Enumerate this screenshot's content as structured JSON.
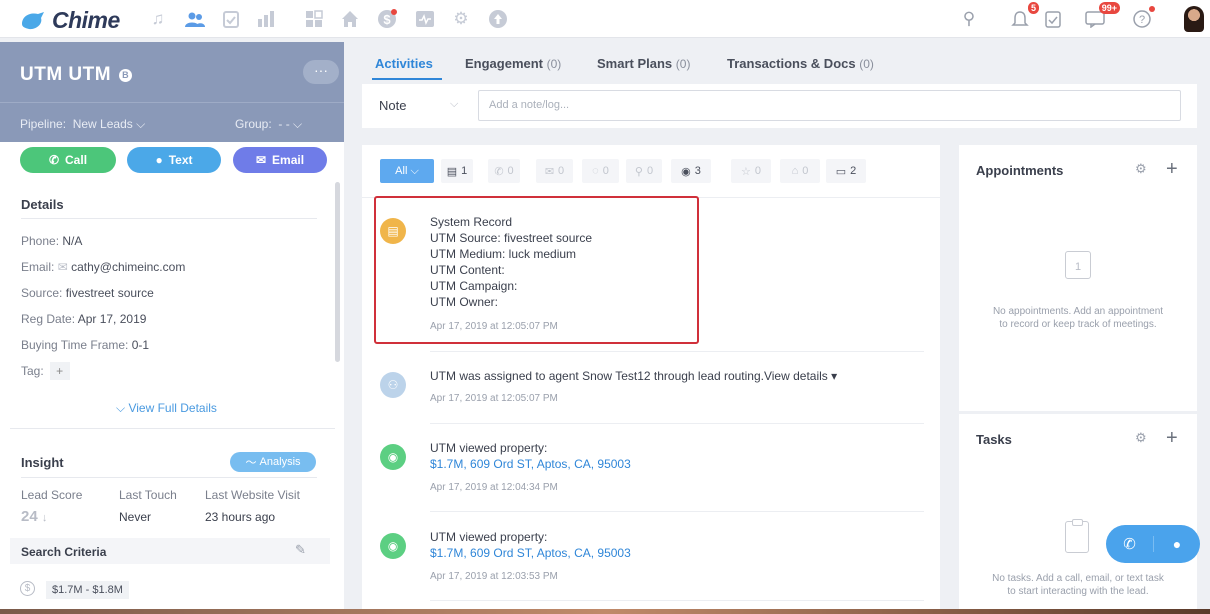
{
  "app": {
    "logo_text": "Chime"
  },
  "nav": {
    "notif_badge": "5",
    "messages_badge": "99+"
  },
  "lead": {
    "name": "UTM UTM",
    "b_badge": "B",
    "more": "···",
    "pipeline_label": "Pipeline:",
    "pipeline_value": "New Leads",
    "group_label": "Group:",
    "group_value": "- -"
  },
  "actions": {
    "call": "Call",
    "text": "Text",
    "email": "Email"
  },
  "details": {
    "title": "Details",
    "phone_label": "Phone:",
    "phone_value": "N/A",
    "email_label": "Email:",
    "email_value": "cathy@chimeinc.com",
    "source_label": "Source:",
    "source_value": "fivestreet source",
    "reg_label": "Reg Date:",
    "reg_value": "Apr 17, 2019",
    "btf_label": "Buying Time Frame:",
    "btf_value": "0-1",
    "tag_label": "Tag:",
    "tag_add": "+",
    "view_full": "View Full Details"
  },
  "insight": {
    "title": "Insight",
    "analysis": "Analysis",
    "lead_score_label": "Lead Score",
    "last_touch_label": "Last Touch",
    "last_visit_label": "Last Website Visit",
    "lead_score": "24",
    "last_touch": "Never",
    "last_visit": "23 hours ago",
    "search_criteria": "Search Criteria",
    "price": "$1.7M - $1.8M"
  },
  "tabs": [
    {
      "label": "Activities",
      "count": ""
    },
    {
      "label": "Engagement",
      "count": "(0)"
    },
    {
      "label": "Smart Plans",
      "count": "(0)"
    },
    {
      "label": "Transactions & Docs",
      "count": "(0)"
    }
  ],
  "note": {
    "type": "Note",
    "placeholder": "Add a note/log..."
  },
  "filters": {
    "all": "All",
    "chips": [
      {
        "icon": "▤",
        "count": "1"
      },
      {
        "icon": "✆",
        "count": "0"
      },
      {
        "icon": "✉",
        "count": "0"
      },
      {
        "icon": "◌",
        "count": "0"
      },
      {
        "icon": "⚲",
        "count": "0"
      },
      {
        "icon": "◉",
        "count": "3"
      },
      {
        "icon": "☆",
        "count": "0"
      },
      {
        "icon": "⌂",
        "count": "0"
      },
      {
        "icon": "▭",
        "count": "2"
      }
    ]
  },
  "activities": [
    {
      "lines": [
        "System Record",
        "UTM Source: fivestreet source",
        "UTM Medium: luck medium",
        "UTM Content:",
        "UTM Campaign:",
        "UTM Owner:"
      ],
      "time": "Apr 17, 2019 at 12:05:07 PM",
      "color": "#f0b54a"
    },
    {
      "text": "UTM was assigned to agent Snow Test12 through lead routing.View details",
      "time": "Apr 17, 2019 at 12:05:07 PM",
      "color": "#bcd3ea"
    },
    {
      "text": "UTM viewed property:",
      "link": "$1.7M, 609 Ord ST, Aptos, CA, 95003",
      "time": "Apr 17, 2019 at 12:04:34 PM",
      "color": "#5ccf82"
    },
    {
      "text": "UTM viewed property:",
      "link": "$1.7M, 609 Ord ST, Aptos, CA, 95003",
      "time": "Apr 17, 2019 at 12:03:53 PM",
      "color": "#5ccf82"
    }
  ],
  "appointments": {
    "title": "Appointments",
    "empty": "No appointments. Add an appointment to record or keep track of meetings.",
    "cal_day": "1"
  },
  "tasks": {
    "title": "Tasks",
    "empty": "No tasks. Add a call, email, or text task to start interacting with the lead."
  }
}
